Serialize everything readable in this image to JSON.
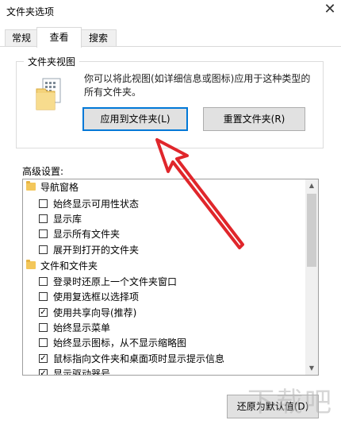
{
  "window": {
    "title": "文件夹选项"
  },
  "tabs": [
    {
      "label": "常规",
      "active": false
    },
    {
      "label": "查看",
      "active": true
    },
    {
      "label": "搜索",
      "active": false
    }
  ],
  "folder_views": {
    "legend": "文件夹视图",
    "description": "你可以将此视图(如详细信息或图标)应用于这种类型的所有文件夹。",
    "apply_button": "应用到文件夹(L)",
    "reset_button": "重置文件夹(R)"
  },
  "advanced": {
    "label": "高级设置:",
    "items": [
      {
        "type": "category",
        "label": "导航窗格"
      },
      {
        "type": "checkbox",
        "label": "始终显示可用性状态",
        "checked": false
      },
      {
        "type": "checkbox",
        "label": "显示库",
        "checked": false
      },
      {
        "type": "checkbox",
        "label": "显示所有文件夹",
        "checked": false
      },
      {
        "type": "checkbox",
        "label": "展开到打开的文件夹",
        "checked": false
      },
      {
        "type": "category",
        "label": "文件和文件夹"
      },
      {
        "type": "checkbox",
        "label": "登录时还原上一个文件夹窗口",
        "checked": false
      },
      {
        "type": "checkbox",
        "label": "使用复选框以选择项",
        "checked": false
      },
      {
        "type": "checkbox",
        "label": "使用共享向导(推荐)",
        "checked": true
      },
      {
        "type": "checkbox",
        "label": "始终显示菜单",
        "checked": false
      },
      {
        "type": "checkbox",
        "label": "始终显示图标，从不显示缩略图",
        "checked": false
      },
      {
        "type": "checkbox",
        "label": "鼠标指向文件夹和桌面项时显示提示信息",
        "checked": true
      },
      {
        "type": "checkbox",
        "label": "显示驱动器号",
        "checked": true
      }
    ],
    "restore_button": "还原为默认值(D)"
  },
  "watermark": "下载吧",
  "colors": {
    "arrow": "#e0262b",
    "folder": "#f3c75b",
    "accent": "#0078d7"
  }
}
